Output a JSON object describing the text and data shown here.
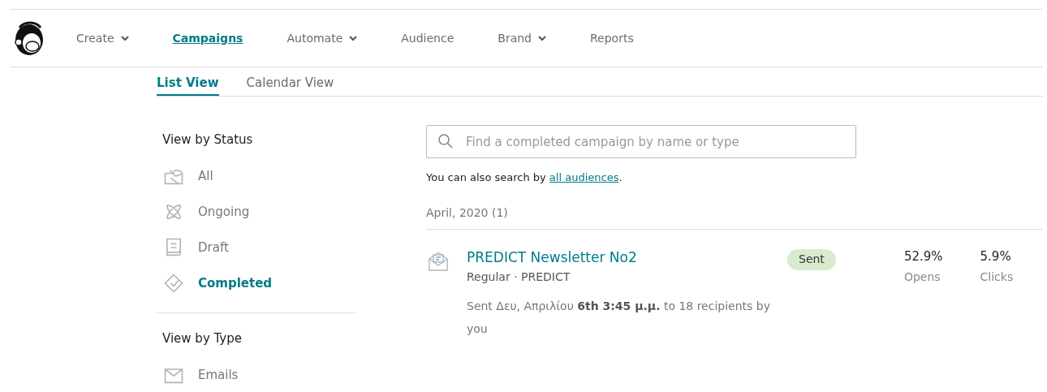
{
  "nav": {
    "items": [
      {
        "label": "Create",
        "dropdown": true,
        "selected": false
      },
      {
        "label": "Campaigns",
        "dropdown": false,
        "selected": true
      },
      {
        "label": "Automate",
        "dropdown": true,
        "selected": false
      },
      {
        "label": "Audience",
        "dropdown": false,
        "selected": false
      },
      {
        "label": "Brand",
        "dropdown": true,
        "selected": false
      },
      {
        "label": "Reports",
        "dropdown": false,
        "selected": false
      }
    ]
  },
  "tabs": [
    {
      "label": "List View",
      "selected": true
    },
    {
      "label": "Calendar View",
      "selected": false
    }
  ],
  "sidebar": {
    "status_heading": "View by Status",
    "status_items": [
      {
        "kind": "all",
        "label": "All",
        "selected": false
      },
      {
        "kind": "ongoing",
        "label": "Ongoing",
        "selected": false
      },
      {
        "kind": "draft",
        "label": "Draft",
        "selected": false
      },
      {
        "kind": "completed",
        "label": "Completed",
        "selected": true
      }
    ],
    "type_heading": "View by Type",
    "type_items": [
      {
        "kind": "emails",
        "label": "Emails",
        "selected": false
      }
    ]
  },
  "search": {
    "placeholder": "Find a completed campaign by name or type"
  },
  "search_hint": {
    "text": "You can also search by ",
    "link": "all audiences",
    "end": "."
  },
  "group": {
    "heading": "April, 2020 (1)",
    "campaigns": [
      {
        "title": "PREDICT Newsletter No2",
        "meta": "Regular · PREDICT",
        "sent_info": "Sent Δευ, Απριλίου **6th 3:45 μ.μ.** to 18 recipients by you",
        "status": "Sent",
        "stats": [
          {
            "value": "52.9%",
            "label": "Opens"
          },
          {
            "value": "5.9%",
            "label": "Clicks"
          }
        ]
      }
    ]
  }
}
